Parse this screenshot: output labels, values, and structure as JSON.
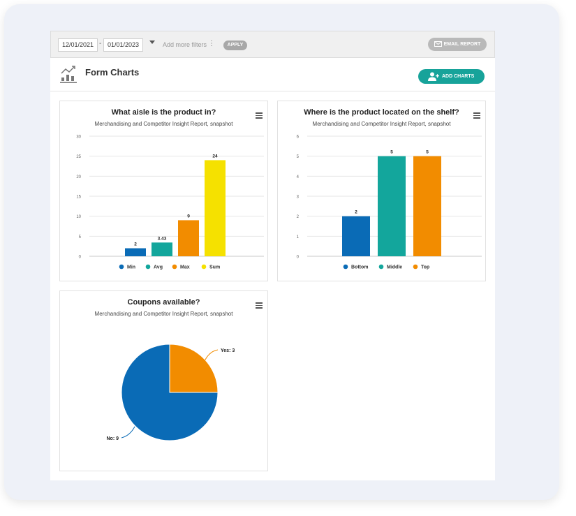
{
  "toolbar": {
    "date_from": "12/01/2021",
    "date_separator": "-",
    "date_to": "01/01/2023",
    "more_filters": "Add more filters",
    "more_icon": "⋮",
    "apply_label": "APPLY",
    "email_label": "EMAIL REPORT"
  },
  "header": {
    "title": "Form Charts",
    "add_charts_label": "ADD CHARTS"
  },
  "colors": {
    "blue": "#0a6bb6",
    "teal": "#13a69c",
    "orange": "#f28c00",
    "yellow": "#f5e100",
    "accent": "#17a39a"
  },
  "chart_data": [
    {
      "type": "bar",
      "title": "What aisle is the product in?",
      "subtitle": "Merchandising and Competitor Insight Report, snapshot",
      "categories": [
        "Min",
        "Avg",
        "Max",
        "Sum"
      ],
      "values": [
        2,
        3.43,
        9,
        24
      ],
      "value_labels": [
        "2",
        "3.43",
        "9",
        "24"
      ],
      "colors": [
        "#0a6bb6",
        "#13a69c",
        "#f28c00",
        "#f5e100"
      ],
      "ylim": [
        0,
        30
      ],
      "yticks": [
        "0",
        "5",
        "10",
        "15",
        "20",
        "25",
        "30"
      ],
      "grid": true,
      "legend": "bottom"
    },
    {
      "type": "bar",
      "title": "Where is the product located on the shelf?",
      "subtitle": "Merchandising and Competitor Insight Report, snapshot",
      "categories": [
        "Bottom",
        "Middle",
        "Top"
      ],
      "values": [
        2,
        5,
        5
      ],
      "value_labels": [
        "2",
        "5",
        "5"
      ],
      "colors": [
        "#0a6bb6",
        "#13a69c",
        "#f28c00"
      ],
      "ylim": [
        0,
        6
      ],
      "yticks": [
        "0",
        "1",
        "2",
        "3",
        "4",
        "5",
        "6"
      ],
      "grid": true,
      "legend": "bottom"
    },
    {
      "type": "pie",
      "title": "Coupons available?",
      "subtitle": "Merchandising and Competitor Insight Report, snapshot",
      "categories": [
        "Yes",
        "No"
      ],
      "values": [
        3,
        9
      ],
      "slice_labels": [
        "Yes: 3",
        "No: 9"
      ],
      "colors": [
        "#f28c00",
        "#0a6bb6"
      ]
    }
  ]
}
